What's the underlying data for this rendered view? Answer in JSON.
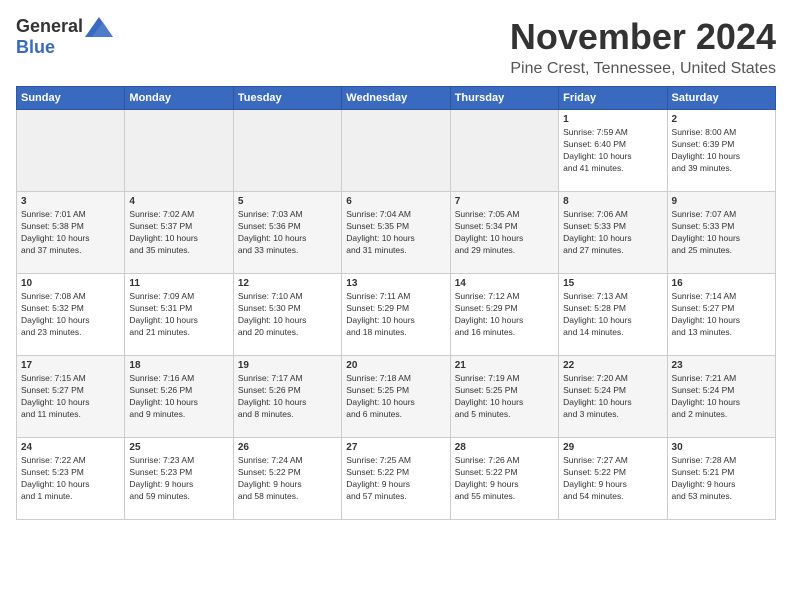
{
  "logo": {
    "general": "General",
    "blue": "Blue"
  },
  "title": "November 2024",
  "location": "Pine Crest, Tennessee, United States",
  "headers": [
    "Sunday",
    "Monday",
    "Tuesday",
    "Wednesday",
    "Thursday",
    "Friday",
    "Saturday"
  ],
  "weeks": [
    [
      {
        "day": "",
        "info": ""
      },
      {
        "day": "",
        "info": ""
      },
      {
        "day": "",
        "info": ""
      },
      {
        "day": "",
        "info": ""
      },
      {
        "day": "",
        "info": ""
      },
      {
        "day": "1",
        "info": "Sunrise: 7:59 AM\nSunset: 6:40 PM\nDaylight: 10 hours\nand 41 minutes."
      },
      {
        "day": "2",
        "info": "Sunrise: 8:00 AM\nSunset: 6:39 PM\nDaylight: 10 hours\nand 39 minutes."
      }
    ],
    [
      {
        "day": "3",
        "info": "Sunrise: 7:01 AM\nSunset: 5:38 PM\nDaylight: 10 hours\nand 37 minutes."
      },
      {
        "day": "4",
        "info": "Sunrise: 7:02 AM\nSunset: 5:37 PM\nDaylight: 10 hours\nand 35 minutes."
      },
      {
        "day": "5",
        "info": "Sunrise: 7:03 AM\nSunset: 5:36 PM\nDaylight: 10 hours\nand 33 minutes."
      },
      {
        "day": "6",
        "info": "Sunrise: 7:04 AM\nSunset: 5:35 PM\nDaylight: 10 hours\nand 31 minutes."
      },
      {
        "day": "7",
        "info": "Sunrise: 7:05 AM\nSunset: 5:34 PM\nDaylight: 10 hours\nand 29 minutes."
      },
      {
        "day": "8",
        "info": "Sunrise: 7:06 AM\nSunset: 5:33 PM\nDaylight: 10 hours\nand 27 minutes."
      },
      {
        "day": "9",
        "info": "Sunrise: 7:07 AM\nSunset: 5:33 PM\nDaylight: 10 hours\nand 25 minutes."
      }
    ],
    [
      {
        "day": "10",
        "info": "Sunrise: 7:08 AM\nSunset: 5:32 PM\nDaylight: 10 hours\nand 23 minutes."
      },
      {
        "day": "11",
        "info": "Sunrise: 7:09 AM\nSunset: 5:31 PM\nDaylight: 10 hours\nand 21 minutes."
      },
      {
        "day": "12",
        "info": "Sunrise: 7:10 AM\nSunset: 5:30 PM\nDaylight: 10 hours\nand 20 minutes."
      },
      {
        "day": "13",
        "info": "Sunrise: 7:11 AM\nSunset: 5:29 PM\nDaylight: 10 hours\nand 18 minutes."
      },
      {
        "day": "14",
        "info": "Sunrise: 7:12 AM\nSunset: 5:29 PM\nDaylight: 10 hours\nand 16 minutes."
      },
      {
        "day": "15",
        "info": "Sunrise: 7:13 AM\nSunset: 5:28 PM\nDaylight: 10 hours\nand 14 minutes."
      },
      {
        "day": "16",
        "info": "Sunrise: 7:14 AM\nSunset: 5:27 PM\nDaylight: 10 hours\nand 13 minutes."
      }
    ],
    [
      {
        "day": "17",
        "info": "Sunrise: 7:15 AM\nSunset: 5:27 PM\nDaylight: 10 hours\nand 11 minutes."
      },
      {
        "day": "18",
        "info": "Sunrise: 7:16 AM\nSunset: 5:26 PM\nDaylight: 10 hours\nand 9 minutes."
      },
      {
        "day": "19",
        "info": "Sunrise: 7:17 AM\nSunset: 5:26 PM\nDaylight: 10 hours\nand 8 minutes."
      },
      {
        "day": "20",
        "info": "Sunrise: 7:18 AM\nSunset: 5:25 PM\nDaylight: 10 hours\nand 6 minutes."
      },
      {
        "day": "21",
        "info": "Sunrise: 7:19 AM\nSunset: 5:25 PM\nDaylight: 10 hours\nand 5 minutes."
      },
      {
        "day": "22",
        "info": "Sunrise: 7:20 AM\nSunset: 5:24 PM\nDaylight: 10 hours\nand 3 minutes."
      },
      {
        "day": "23",
        "info": "Sunrise: 7:21 AM\nSunset: 5:24 PM\nDaylight: 10 hours\nand 2 minutes."
      }
    ],
    [
      {
        "day": "24",
        "info": "Sunrise: 7:22 AM\nSunset: 5:23 PM\nDaylight: 10 hours\nand 1 minute."
      },
      {
        "day": "25",
        "info": "Sunrise: 7:23 AM\nSunset: 5:23 PM\nDaylight: 9 hours\nand 59 minutes."
      },
      {
        "day": "26",
        "info": "Sunrise: 7:24 AM\nSunset: 5:22 PM\nDaylight: 9 hours\nand 58 minutes."
      },
      {
        "day": "27",
        "info": "Sunrise: 7:25 AM\nSunset: 5:22 PM\nDaylight: 9 hours\nand 57 minutes."
      },
      {
        "day": "28",
        "info": "Sunrise: 7:26 AM\nSunset: 5:22 PM\nDaylight: 9 hours\nand 55 minutes."
      },
      {
        "day": "29",
        "info": "Sunrise: 7:27 AM\nSunset: 5:22 PM\nDaylight: 9 hours\nand 54 minutes."
      },
      {
        "day": "30",
        "info": "Sunrise: 7:28 AM\nSunset: 5:21 PM\nDaylight: 9 hours\nand 53 minutes."
      }
    ]
  ]
}
